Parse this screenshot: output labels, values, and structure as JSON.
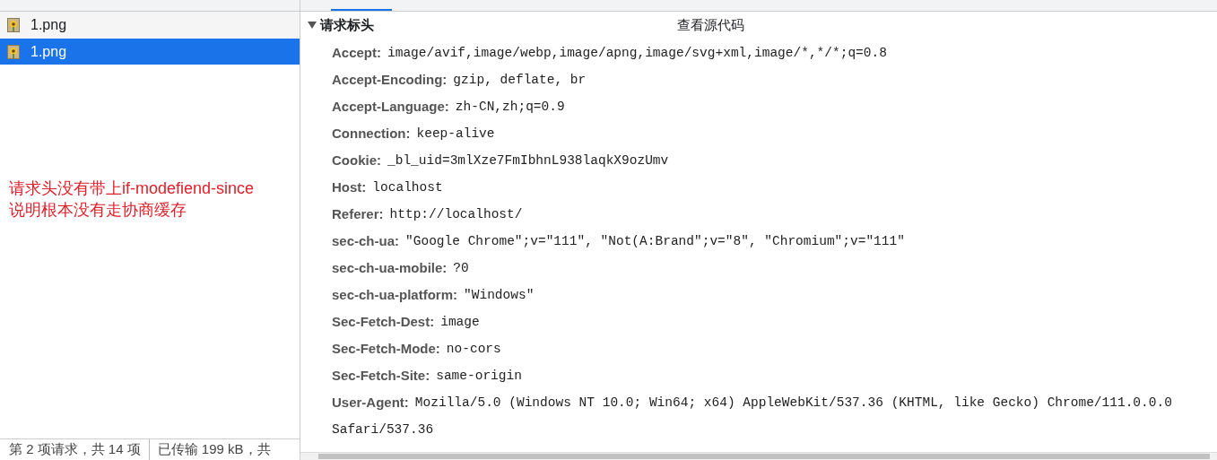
{
  "file_list": {
    "rows": [
      {
        "name": "1.png",
        "selected": false
      },
      {
        "name": "1.png",
        "selected": true
      }
    ]
  },
  "annotation": "请求头没有带上if-modefiend-since\n说明根本没有走协商缓存",
  "status_bar": [
    "第 2 项请求，共 14 项",
    "已传输 199 kB，共"
  ],
  "request_headers": {
    "expanded": true,
    "title": "请求标头",
    "view_source": "查看源代码",
    "headers": [
      {
        "name": "Accept:",
        "value": "image/avif,image/webp,image/apng,image/svg+xml,image/*,*/*;q=0.8"
      },
      {
        "name": "Accept-Encoding:",
        "value": "gzip, deflate, br"
      },
      {
        "name": "Accept-Language:",
        "value": "zh-CN,zh;q=0.9"
      },
      {
        "name": "Connection:",
        "value": "keep-alive"
      },
      {
        "name": "Cookie:",
        "value": "_bl_uid=3mlXze7FmIbhnL938laqkX9ozUmv"
      },
      {
        "name": "Host:",
        "value": "localhost"
      },
      {
        "name": "Referer:",
        "value": "http://localhost/"
      },
      {
        "name": "sec-ch-ua:",
        "value": "\"Google Chrome\";v=\"111\", \"Not(A:Brand\";v=\"8\", \"Chromium\";v=\"111\""
      },
      {
        "name": "sec-ch-ua-mobile:",
        "value": "?0"
      },
      {
        "name": "sec-ch-ua-platform:",
        "value": "\"Windows\""
      },
      {
        "name": "Sec-Fetch-Dest:",
        "value": "image"
      },
      {
        "name": "Sec-Fetch-Mode:",
        "value": "no-cors"
      },
      {
        "name": "Sec-Fetch-Site:",
        "value": "same-origin"
      },
      {
        "name": "User-Agent:",
        "value": "Mozilla/5.0 (Windows NT 10.0; Win64; x64) AppleWebKit/537.36 (KHTML, like Gecko) Chrome/111.0.0.0 Safari/537.36"
      }
    ]
  }
}
